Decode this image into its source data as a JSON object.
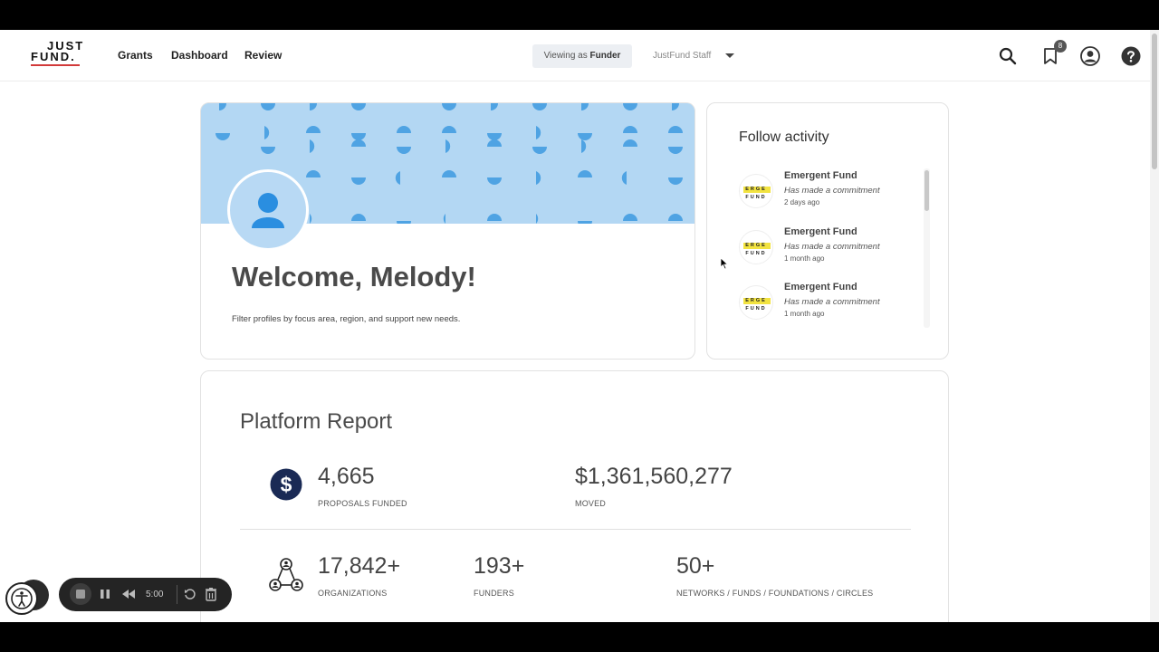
{
  "header": {
    "logo_line1": "JUST",
    "logo_line2": "FUND.",
    "nav": [
      "Grants",
      "Dashboard",
      "Review"
    ],
    "viewing_prefix": "Viewing as",
    "viewing_role": "Funder",
    "account_select": "JustFund Staff",
    "notification_count": "8",
    "icons": [
      "search-icon",
      "bookmark-icon",
      "account-icon",
      "help-icon"
    ]
  },
  "welcome": {
    "title": "Welcome, Melody!",
    "subtitle": "Filter profiles by focus area, region, and support new needs."
  },
  "follow_activity": {
    "title": "Follow activity",
    "items": [
      {
        "logo_line1": "ERGE",
        "logo_line2": "FUND",
        "name": "Emergent Fund",
        "action": "Has made a commitment",
        "time": "2 days ago"
      },
      {
        "logo_line1": "ERGE",
        "logo_line2": "FUND",
        "name": "Emergent Fund",
        "action": "Has made a commitment",
        "time": "1 month ago"
      },
      {
        "logo_line1": "ERGE",
        "logo_line2": "FUND",
        "name": "Emergent Fund",
        "action": "Has made a commitment",
        "time": "1 month ago"
      }
    ]
  },
  "platform_report": {
    "title": "Platform Report",
    "row1": [
      {
        "value": "4,665",
        "label": "PROPOSALS FUNDED"
      },
      {
        "value": "$1,361,560,277",
        "label": "MOVED"
      }
    ],
    "row2": [
      {
        "value": "17,842+",
        "label": "ORGANIZATIONS"
      },
      {
        "value": "193+",
        "label": "FUNDERS"
      },
      {
        "value": "50+",
        "label": "NETWORKS / FUNDS / FOUNDATIONS / CIRCLES"
      }
    ]
  },
  "recorder": {
    "time": "5:00"
  },
  "colors": {
    "banner": "#b3d7f3",
    "banner_shapes": "#4fa3e3",
    "avatar_figure": "#2a8ee0",
    "dollar_icon": "#1a2a55",
    "logo_underline": "#d23a3a",
    "fund_logo_yellow": "#f2e341"
  }
}
